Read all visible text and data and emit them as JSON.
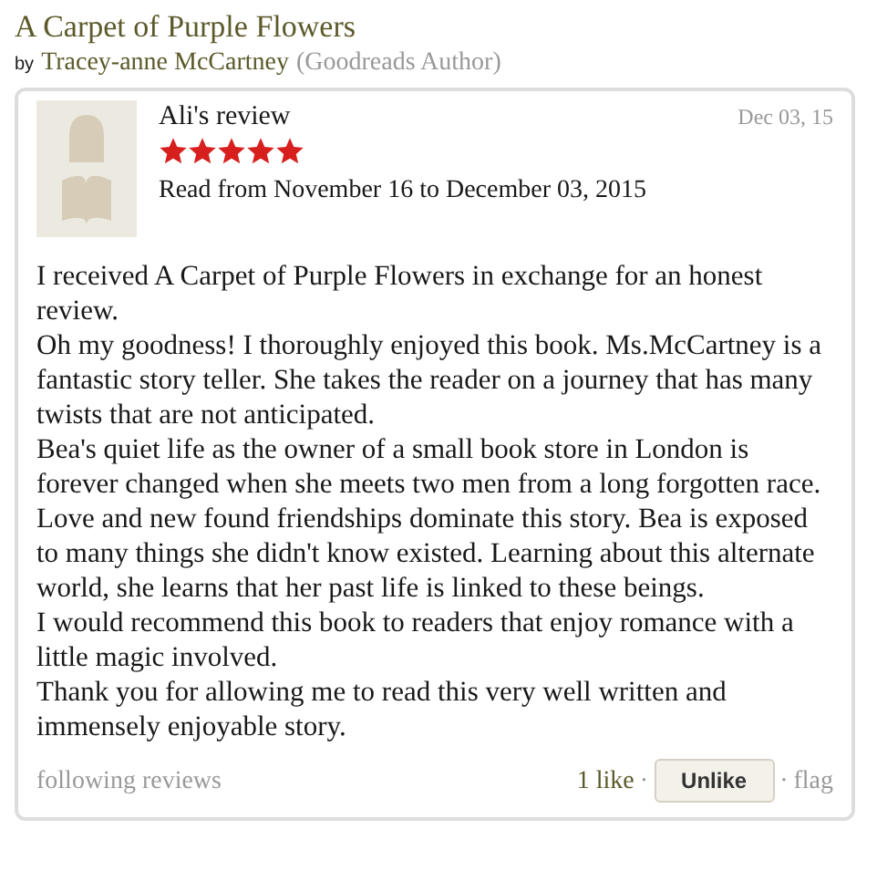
{
  "book": {
    "title": "A Carpet of Purple Flowers",
    "by": "by",
    "author": "Tracey-anne McCartney",
    "author_note": "(Goodreads Author)"
  },
  "review": {
    "heading": "Ali's review",
    "date": "Dec 03, 15",
    "stars": 5,
    "read_dates": "Read from November 16 to December 03, 2015",
    "paragraphs": [
      "I received A Carpet of Purple Flowers in exchange for an honest review.",
      "Oh my goodness! I thoroughly enjoyed this book. Ms.McCartney is a fantastic story teller. She takes the reader on a journey that has many twists that are not anticipated.",
      "Bea's quiet life as the owner of a small book store in London is forever changed when she meets two men from a long forgotten race.",
      "Love and new found friendships dominate this story. Bea is exposed to many things she didn't know existed. Learning about this alternate world, she learns that her past life is linked to these beings.",
      "I would recommend this book to readers that enjoy romance with a little magic involved.",
      "Thank you for allowing me to read this very well written and immensely enjoyable story."
    ]
  },
  "footer": {
    "link": "following reviews",
    "likes": "1 like",
    "separator_1": "·",
    "button": "Unlike",
    "separator_2": "·",
    "flag": "flag"
  }
}
